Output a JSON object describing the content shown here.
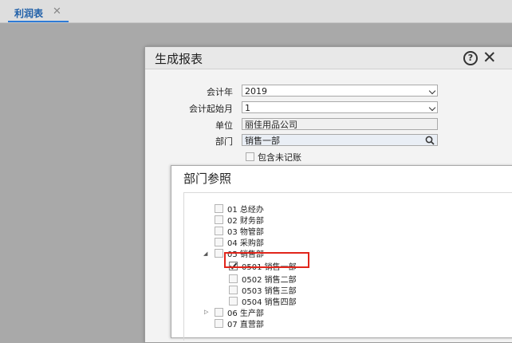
{
  "tab": {
    "label": "利润表",
    "close": "✕"
  },
  "dialog": {
    "title": "生成报表",
    "help": "?",
    "close": "✕",
    "form": {
      "year_label": "会计年",
      "year_value": "2019",
      "start_month_label": "会计起始月",
      "start_month_value": "1",
      "unit_label": "单位",
      "unit_value": "丽佳用品公司",
      "dept_label": "部门",
      "dept_value": "销售一部",
      "include_label": "包含未记账"
    }
  },
  "panel": {
    "title": "部门参照",
    "items": [
      {
        "label": "01 总经办",
        "checked": false
      },
      {
        "label": "02 财务部",
        "checked": false
      },
      {
        "label": "03 物管部",
        "checked": false
      },
      {
        "label": "04 采购部",
        "checked": false
      },
      {
        "label": "05 销售部",
        "checked": false,
        "expanded": true
      },
      {
        "label": "0501 销售一部",
        "checked": true
      },
      {
        "label": "0502 销售二部",
        "checked": false
      },
      {
        "label": "0503 销售三部",
        "checked": false
      },
      {
        "label": "0504 销售四部",
        "checked": false
      },
      {
        "label": "06 生产部",
        "checked": false,
        "expanded": false
      },
      {
        "label": "07 直营部",
        "checked": false
      }
    ]
  }
}
